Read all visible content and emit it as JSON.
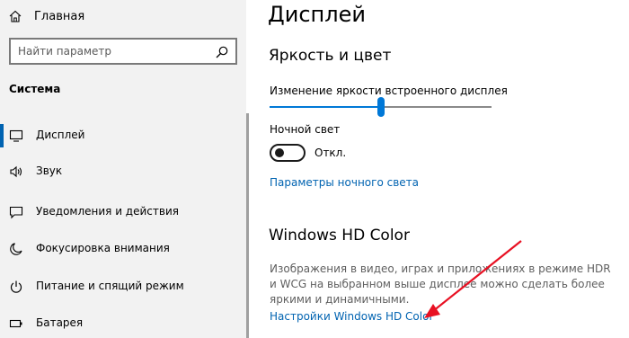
{
  "sidebar": {
    "home_label": "Главная",
    "search_placeholder": "Найти параметр",
    "section_title": "Система",
    "items": [
      {
        "label": "Дисплей",
        "icon": "monitor-icon",
        "selected": true
      },
      {
        "label": "Звук",
        "icon": "speaker-icon",
        "selected": false
      },
      {
        "label": "Уведомления и действия",
        "icon": "notification-icon",
        "selected": false
      },
      {
        "label": "Фокусировка внимания",
        "icon": "moon-icon",
        "selected": false
      },
      {
        "label": "Питание и спящий режим",
        "icon": "power-icon",
        "selected": false
      },
      {
        "label": "Батарея",
        "icon": "battery-icon",
        "selected": false
      }
    ]
  },
  "main": {
    "title": "Дисплей",
    "brightness": {
      "heading": "Яркость и цвет",
      "slider_label": "Изменение яркости встроенного дисплея",
      "level_percent": 50
    },
    "night_light": {
      "label": "Ночной свет",
      "state_label": "Откл.",
      "on": false,
      "settings_link": "Параметры ночного света"
    },
    "hd_color": {
      "heading": "Windows HD Color",
      "description": "Изображения в видео, играх и приложениях в режиме HDR и WCG на выбранном выше дисплее можно сделать более яркими и динамичными.",
      "settings_link": "Настройки Windows HD Color"
    }
  },
  "colors": {
    "accent": "#0078d7",
    "link": "#0063b1",
    "sidebar_bg": "#f2f2f2",
    "annotation_arrow": "#e81123"
  }
}
